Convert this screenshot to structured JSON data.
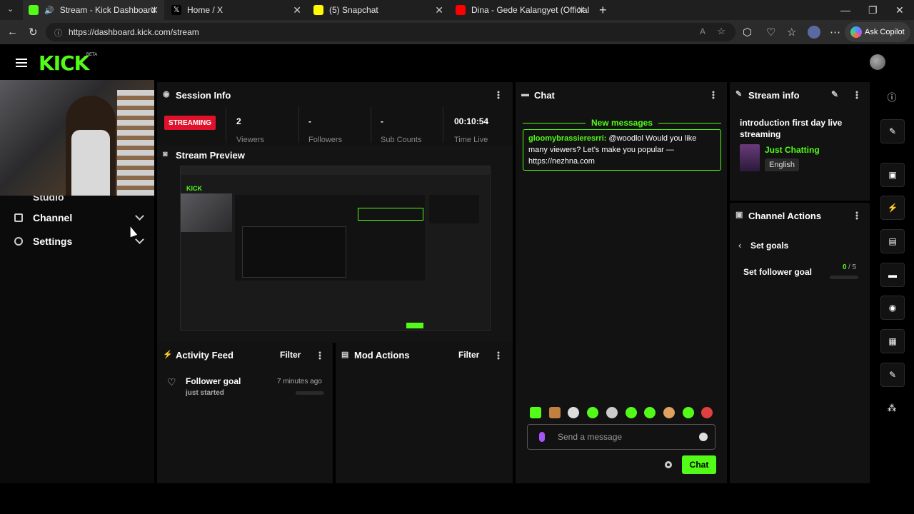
{
  "browser": {
    "tabs": [
      {
        "title": "Stream - Kick Dashboard",
        "favicon_color": "#53fc18",
        "active": true
      },
      {
        "title": "Home / X",
        "favicon_color": "#000000",
        "active": false
      },
      {
        "title": "(5) Snapchat",
        "favicon_color": "#fffc00",
        "active": false
      },
      {
        "title": "Dina - Gede Kalangyet (Official Vi",
        "favicon_color": "#ff0000",
        "active": false
      }
    ],
    "url": "https://dashboard.kick.com/stream",
    "copilot_label": "Ask Copilot"
  },
  "app": {
    "logo": "KICK",
    "beta": "BETA"
  },
  "sidebar": {
    "items": [
      {
        "label": "Studio"
      },
      {
        "label": "Channel"
      },
      {
        "label": "Settings"
      }
    ]
  },
  "session_info": {
    "title": "Session Info",
    "status": "STREAMING",
    "stats": [
      {
        "value": "2",
        "label": "Viewers"
      },
      {
        "value": "-",
        "label": "Followers"
      },
      {
        "value": "-",
        "label": "Sub Counts"
      },
      {
        "value": "00:10:54",
        "label": "Time Live"
      }
    ]
  },
  "stream_preview": {
    "title": "Stream Preview"
  },
  "activity_feed": {
    "title": "Activity Feed",
    "filter_label": "Filter",
    "items": [
      {
        "title": "Follower goal",
        "subtitle": "just started",
        "time": "7 minutes ago"
      }
    ]
  },
  "mod_actions": {
    "title": "Mod Actions",
    "filter_label": "Filter"
  },
  "chat": {
    "title": "Chat",
    "new_messages_label": "New messages",
    "messages": [
      {
        "user": "gloomybrassieresrri:",
        "text": " @woodlol Would you like many viewers? Let's make you popular — https://nezhna.com"
      }
    ],
    "input_placeholder": "Send a message",
    "send_label": "Chat"
  },
  "stream_info": {
    "title": "Stream info",
    "stream_title": "introduction first day live streaming",
    "category": "Just Chatting",
    "language": "English"
  },
  "channel_actions": {
    "title": "Channel Actions",
    "back_label": "Set goals",
    "goal_label": "Set follower goal",
    "goal_current": "0",
    "goal_target": "/ 5"
  },
  "colors": {
    "accent": "#53fc18",
    "streaming": "#e0112b"
  }
}
